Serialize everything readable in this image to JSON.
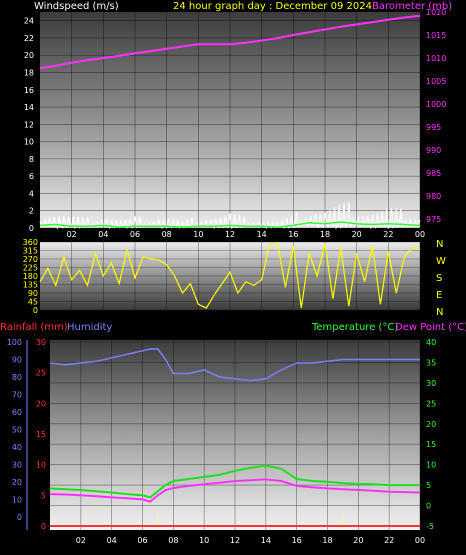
{
  "colors": {
    "background": "#000000",
    "wind_speed": "#e8e8e8",
    "wind_gust": "#ffffff",
    "wind_avg": "#33ff33",
    "barometer": "#ff33ff",
    "wind_direction": "#ffff00",
    "rainfall": "#ff3333",
    "humidity": "#8080ff",
    "temperature": "#22dd22",
    "dew_point": "#ff33ff",
    "time_tick_marks": "#ffff66"
  },
  "header": {
    "windspeed_label": "Windspeed (m/s)",
    "title": "24 hour graph day : December 09 2024",
    "barometer_label": "Barometer (mb)"
  },
  "lower_header": {
    "rainfall_label": "Rainfall (mm)",
    "humidity_label": "Humidity",
    "temperature_label": "Temperature (°C)",
    "dew_point_label": "Dew Point (°C)"
  },
  "compass_labels": [
    "N",
    "W",
    "S",
    "E",
    "N"
  ],
  "x_ticks": [
    "02",
    "04",
    "06",
    "08",
    "10",
    "12",
    "14",
    "16",
    "18",
    "20",
    "22",
    "00"
  ],
  "chart_data": [
    {
      "type": "line",
      "name": "wind-and-barometer",
      "title": "24 hour graph day : December 09 2024",
      "x_ticks": [
        "02",
        "04",
        "06",
        "08",
        "10",
        "12",
        "14",
        "16",
        "18",
        "20",
        "22",
        "00"
      ],
      "x_range_hours": [
        0,
        24
      ],
      "y_left": {
        "label": "Windspeed (m/s)",
        "range": [
          0,
          25
        ],
        "ticks": [
          0,
          2,
          4,
          6,
          8,
          10,
          12,
          14,
          16,
          18,
          20,
          22,
          24
        ]
      },
      "y_right": {
        "label": "Barometer (mb)",
        "range": [
          973,
          1020
        ],
        "ticks": [
          975,
          980,
          985,
          990,
          995,
          1000,
          1005,
          1010,
          1015,
          1020
        ]
      },
      "series": [
        {
          "name": "Barometer (mb)",
          "axis": "right",
          "x": [
            0,
            1,
            2,
            3,
            4,
            5,
            6,
            7,
            8,
            9,
            10,
            11,
            12,
            13,
            14,
            15,
            16,
            17,
            18,
            19,
            20,
            21,
            22,
            23,
            24
          ],
          "y": [
            1007.8,
            1008.3,
            1009.0,
            1009.5,
            1010.0,
            1010.5,
            1011.0,
            1011.5,
            1012.0,
            1012.5,
            1013.0,
            1013.0,
            1013.0,
            1013.3,
            1013.8,
            1014.3,
            1015.0,
            1015.6,
            1016.2,
            1016.8,
            1017.3,
            1017.8,
            1018.3,
            1018.8,
            1019.2
          ]
        },
        {
          "name": "Wind gust",
          "axis": "left",
          "x": [
            0,
            1,
            2,
            3,
            4,
            5,
            6,
            7,
            8,
            9,
            10,
            11,
            12,
            13,
            14,
            15,
            16,
            17,
            18,
            19,
            20,
            21,
            22,
            23,
            24
          ],
          "y": [
            1.2,
            1.5,
            1.0,
            0.8,
            1.2,
            0.6,
            0.9,
            0.8,
            1.1,
            0.5,
            0.9,
            1.0,
            1.3,
            0.8,
            0.7,
            0.5,
            1.0,
            1.8,
            1.6,
            2.0,
            1.8,
            1.5,
            1.7,
            1.4,
            1.0
          ]
        },
        {
          "name": "Wind average",
          "axis": "left",
          "x": [
            0,
            1,
            2,
            3,
            4,
            5,
            6,
            7,
            8,
            9,
            10,
            11,
            12,
            13,
            14,
            15,
            16,
            17,
            18,
            19,
            20,
            21,
            22,
            23,
            24
          ],
          "y": [
            0.3,
            0.4,
            0.2,
            0.2,
            0.3,
            0.1,
            0.2,
            0.2,
            0.2,
            0.1,
            0.2,
            0.2,
            0.3,
            0.2,
            0.2,
            0.1,
            0.3,
            0.6,
            0.5,
            0.7,
            0.5,
            0.4,
            0.5,
            0.4,
            0.3
          ]
        }
      ]
    },
    {
      "type": "line",
      "name": "wind-direction",
      "x_ticks": [
        "02",
        "04",
        "06",
        "08",
        "10",
        "12",
        "14",
        "16",
        "18",
        "20",
        "22",
        "00"
      ],
      "x_range_hours": [
        0,
        24
      ],
      "y_left": {
        "range": [
          0,
          360
        ],
        "ticks": [
          0,
          45,
          90,
          135,
          180,
          225,
          270,
          315,
          360
        ]
      },
      "y_right_labels": [
        "N",
        "W",
        "S",
        "E",
        "N"
      ],
      "series": [
        {
          "name": "Wind direction",
          "x": [
            0,
            0.5,
            1,
            1.5,
            2,
            2.5,
            3,
            3.5,
            4,
            4.5,
            5,
            5.5,
            6,
            6.5,
            7,
            7.5,
            8,
            8.5,
            9,
            9.5,
            10,
            10.5,
            11,
            11.5,
            12,
            12.5,
            13,
            13.5,
            14,
            14.5,
            15,
            15.5,
            16,
            16.5,
            17,
            17.5,
            18,
            18.5,
            19,
            19.5,
            20,
            20.5,
            21,
            21.5,
            22,
            22.5,
            23,
            23.5,
            24
          ],
          "y": [
            150,
            220,
            130,
            280,
            160,
            210,
            130,
            300,
            180,
            250,
            140,
            320,
            170,
            280,
            270,
            265,
            240,
            180,
            90,
            140,
            30,
            10,
            80,
            140,
            200,
            90,
            150,
            130,
            160,
            350,
            355,
            120,
            340,
            10,
            300,
            180,
            350,
            60,
            330,
            20,
            300,
            150,
            340,
            30,
            310,
            90,
            280,
            330,
            320
          ]
        }
      ]
    },
    {
      "type": "line",
      "name": "rain-humidity-temperature",
      "x_ticks": [
        "02",
        "04",
        "06",
        "08",
        "10",
        "12",
        "14",
        "16",
        "18",
        "20",
        "22",
        "00"
      ],
      "x_range_hours": [
        0,
        24
      ],
      "y_axes": {
        "humidity": {
          "range": [
            -5,
            100
          ],
          "ticks": [
            0,
            10,
            20,
            30,
            40,
            50,
            60,
            70,
            80,
            90,
            100
          ]
        },
        "rainfall": {
          "range": [
            0,
            30
          ],
          "ticks": [
            0,
            5,
            10,
            15,
            20,
            25,
            30
          ]
        },
        "temperature": {
          "range": [
            -5,
            40
          ],
          "ticks": [
            -5,
            0,
            5,
            10,
            15,
            20,
            25,
            30,
            35,
            40
          ]
        }
      },
      "series": [
        {
          "name": "Humidity",
          "axis": "humidity",
          "x": [
            0,
            1,
            2,
            3,
            4,
            5,
            6,
            6.5,
            7,
            7.5,
            8,
            9,
            10,
            11,
            12,
            13,
            14,
            15,
            16,
            17,
            18,
            19,
            20,
            21,
            22,
            23,
            24
          ],
          "y": [
            88,
            87,
            88,
            89,
            91,
            93,
            95,
            96,
            96,
            90,
            82,
            82,
            84,
            80,
            79,
            78,
            79,
            84,
            88,
            88,
            89,
            90,
            90,
            90,
            90,
            90,
            90
          ]
        },
        {
          "name": "Temperature (°C)",
          "axis": "temperature",
          "x": [
            0,
            1,
            2,
            3,
            4,
            5,
            6,
            6.5,
            7,
            7.5,
            8,
            9,
            10,
            11,
            12,
            13,
            14,
            15,
            16,
            17,
            18,
            19,
            20,
            21,
            22,
            23,
            24
          ],
          "y": [
            4.2,
            4.0,
            3.8,
            3.5,
            3.2,
            2.8,
            2.5,
            2.0,
            3.5,
            5.0,
            6.0,
            6.5,
            7.0,
            7.5,
            8.5,
            9.2,
            9.8,
            9.0,
            6.5,
            6.0,
            5.8,
            5.5,
            5.3,
            5.2,
            5.0,
            5.0,
            5.0
          ]
        },
        {
          "name": "Dew Point (°C)",
          "axis": "temperature",
          "x": [
            0,
            1,
            2,
            3,
            4,
            5,
            6,
            6.5,
            7,
            7.5,
            8,
            9,
            10,
            11,
            12,
            13,
            14,
            15,
            16,
            17,
            18,
            19,
            20,
            21,
            22,
            23,
            24
          ],
          "y": [
            2.8,
            2.7,
            2.5,
            2.3,
            2.0,
            1.8,
            1.5,
            1.0,
            2.5,
            3.8,
            4.3,
            4.8,
            5.2,
            5.6,
            6.0,
            6.2,
            6.4,
            6.0,
            4.8,
            4.5,
            4.2,
            4.0,
            3.8,
            3.6,
            3.4,
            3.3,
            3.2
          ]
        },
        {
          "name": "Rainfall (mm)",
          "axis": "rainfall",
          "x": [
            0,
            24
          ],
          "y": [
            0,
            0
          ]
        }
      ]
    }
  ]
}
